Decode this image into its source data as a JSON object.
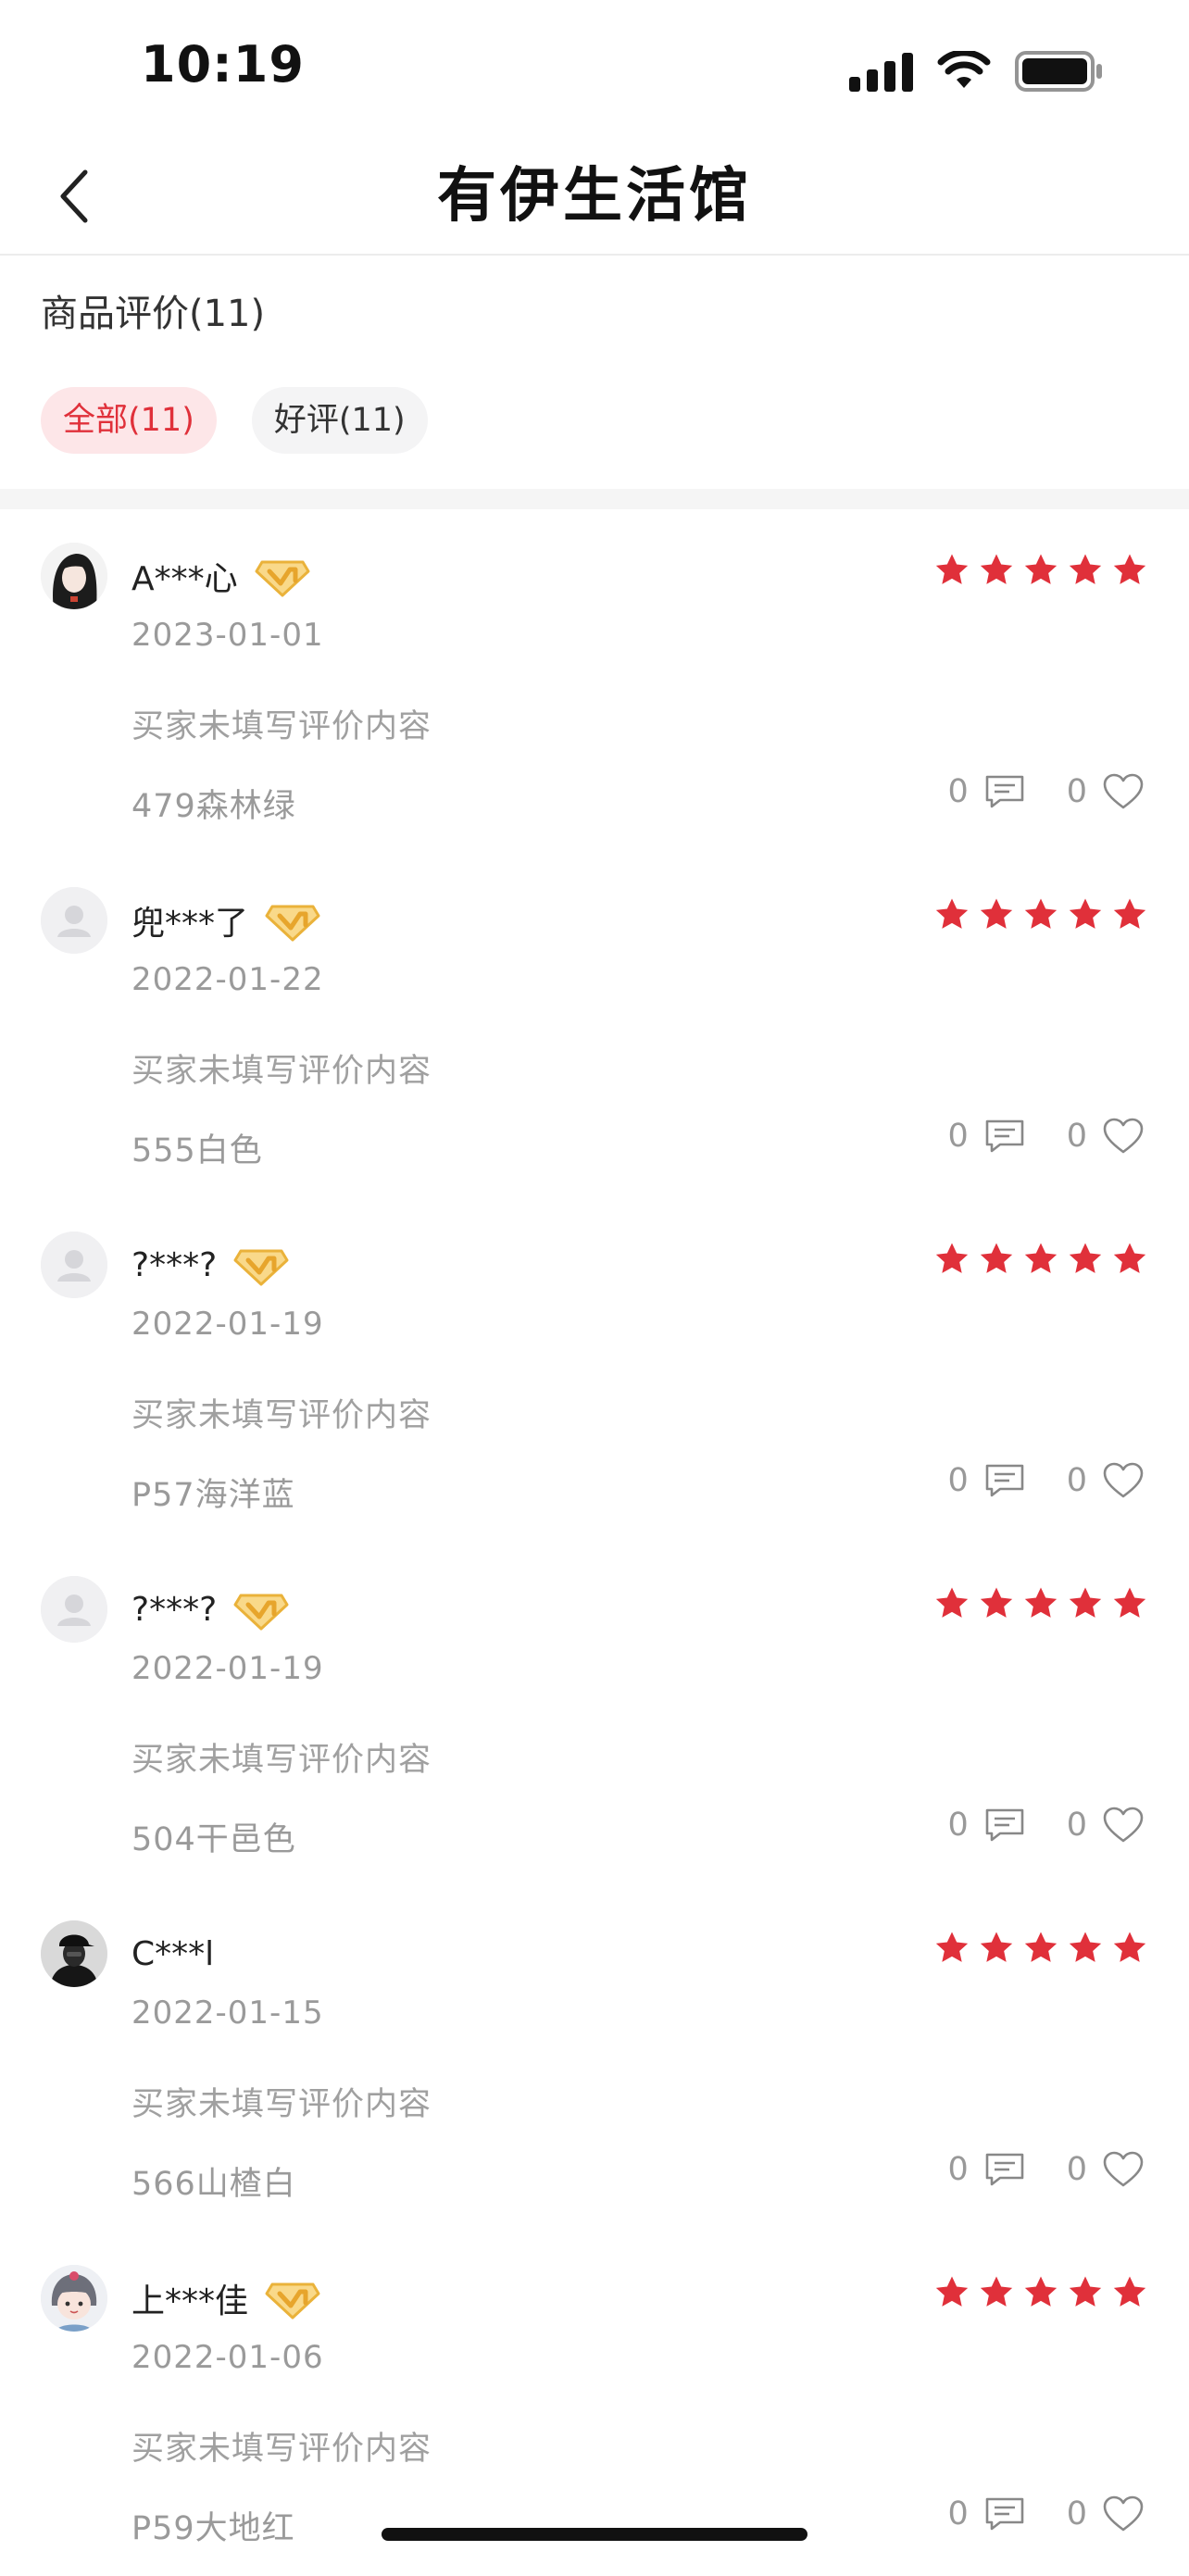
{
  "status_bar": {
    "time": "10:19"
  },
  "nav": {
    "title": "有伊生活馆"
  },
  "section": {
    "title": "商品评价(11)"
  },
  "filters": [
    {
      "label": "全部(11)",
      "active": true
    },
    {
      "label": "好评(11)",
      "active": false
    }
  ],
  "colors": {
    "accent": "#e0303a",
    "star": "#e0303a",
    "vip_gold": "#f2b83c",
    "muted_text": "#9a9a9a"
  },
  "reviews": [
    {
      "user": "A***心",
      "vip": true,
      "avatar": "dark-hair-avatar",
      "rating": 5,
      "date": "2023-01-01",
      "content": "买家未填写评价内容",
      "spec": "479森林绿",
      "comments": "0",
      "likes": "0"
    },
    {
      "user": "兜***了",
      "vip": true,
      "avatar": "default-avatar",
      "rating": 5,
      "date": "2022-01-22",
      "content": "买家未填写评价内容",
      "spec": "555白色",
      "comments": "0",
      "likes": "0"
    },
    {
      "user": "?***?",
      "vip": true,
      "avatar": "default-avatar",
      "rating": 5,
      "date": "2022-01-19",
      "content": "买家未填写评价内容",
      "spec": "P57海洋蓝",
      "comments": "0",
      "likes": "0"
    },
    {
      "user": "?***?",
      "vip": true,
      "avatar": "default-avatar",
      "rating": 5,
      "date": "2022-01-19",
      "content": "买家未填写评价内容",
      "spec": "504干邑色",
      "comments": "0",
      "likes": "0"
    },
    {
      "user": "C***l",
      "vip": false,
      "avatar": "cap-avatar",
      "rating": 5,
      "date": "2022-01-15",
      "content": "买家未填写评价内容",
      "spec": "566山楂白",
      "comments": "0",
      "likes": "0"
    },
    {
      "user": "上***佳",
      "vip": true,
      "avatar": "cartoon-girl-avatar",
      "rating": 5,
      "date": "2022-01-06",
      "content": "买家未填写评价内容",
      "spec": "P59大地红",
      "comments": "0",
      "likes": "0"
    }
  ]
}
